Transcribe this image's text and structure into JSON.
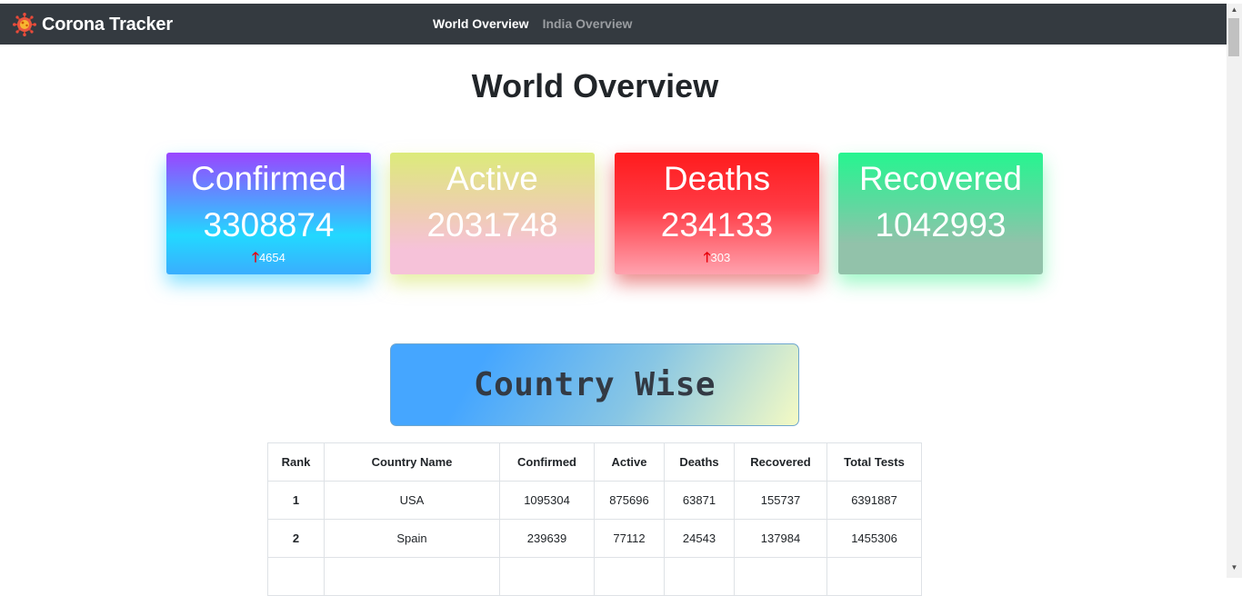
{
  "navbar": {
    "brand": "Corona Tracker",
    "links": [
      {
        "label": "World Overview",
        "active": true
      },
      {
        "label": "India Overview",
        "active": false
      }
    ]
  },
  "page": {
    "title": "World Overview"
  },
  "cards": [
    {
      "title": "Confirmed",
      "value": "3308874",
      "delta": "4654"
    },
    {
      "title": "Active",
      "value": "2031748",
      "delta": ""
    },
    {
      "title": "Deaths",
      "value": "234133",
      "delta": "303"
    },
    {
      "title": "Recovered",
      "value": "1042993",
      "delta": ""
    }
  ],
  "country_section": {
    "title": "Country Wise"
  },
  "table": {
    "headers": [
      "Rank",
      "Country Name",
      "Confirmed",
      "Active",
      "Deaths",
      "Recovered",
      "Total Tests"
    ],
    "rows": [
      [
        "1",
        "USA",
        "1095304",
        "875696",
        "63871",
        "155737",
        "6391887"
      ],
      [
        "2",
        "Spain",
        "239639",
        "77112",
        "24543",
        "137984",
        "1455306"
      ],
      [
        "",
        "",
        "",
        "",
        "",
        "",
        ""
      ]
    ]
  },
  "colors": {
    "navbar_bg": "#343a40",
    "up_arrow": "#e8000b"
  },
  "icons": {
    "brand": "virus-icon",
    "delta": "arrow-up-icon"
  }
}
